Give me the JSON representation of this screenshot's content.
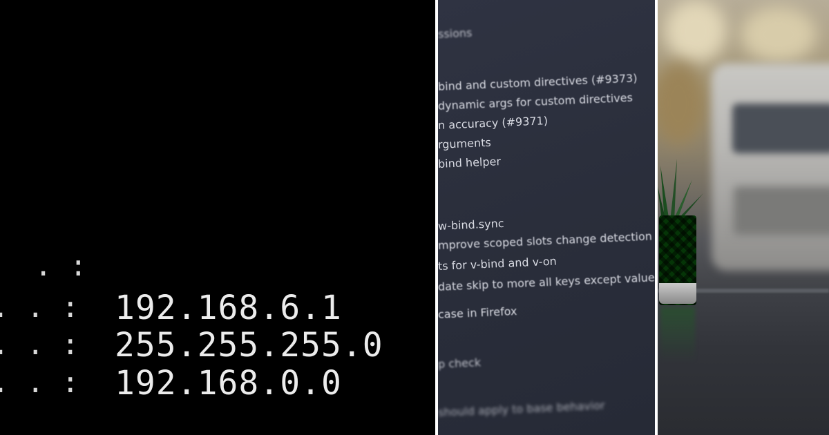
{
  "terminal": {
    "dots_row0": ". :",
    "rows": [
      {
        "dots": ". . :",
        "value": "192.168.6.1"
      },
      {
        "dots": ". . :",
        "value": "255.255.255.0"
      },
      {
        "dots": ". . :",
        "value": "192.168.0.0"
      }
    ]
  },
  "changelog": {
    "lines": [
      "ssions",
      "bind and custom directives (#9373)",
      "dynamic args for custom directives",
      "n accuracy (#9371)",
      "rguments",
      "bind helper",
      "w-bind.sync",
      "mprove scoped slots change detection a",
      "ts for v-bind and v-on",
      "date skip to more all keys except value",
      "case in Firefox",
      "p check",
      "should apply to base behavior"
    ]
  },
  "colors": {
    "terminal_bg": "#000000",
    "terminal_text": "#ececec",
    "changelog_bg": "#2c303d",
    "changelog_text": "#d9dbe3",
    "divider": "#ffffff"
  }
}
